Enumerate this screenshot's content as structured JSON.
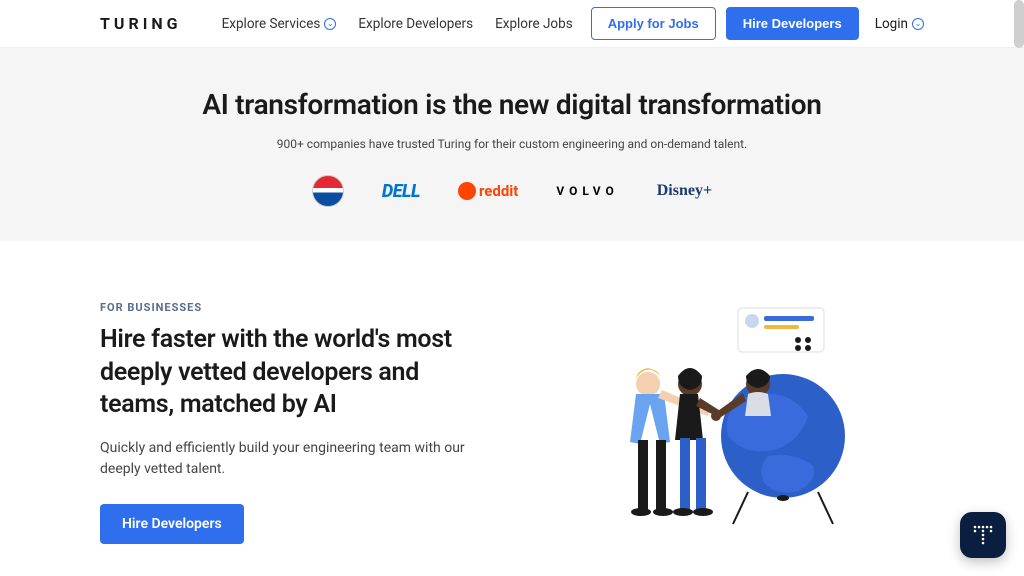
{
  "header": {
    "logo": "TURING",
    "nav": {
      "explore_services": "Explore Services",
      "explore_developers": "Explore Developers",
      "explore_jobs": "Explore Jobs"
    },
    "apply_jobs": "Apply for Jobs",
    "hire_devs": "Hire Developers",
    "login": "Login"
  },
  "hero": {
    "title": "AI transformation is the new digital transformation",
    "subtitle": "900+ companies have trusted Turing for their custom engineering and on-demand talent.",
    "logos": {
      "pepsi": "PEPSI",
      "dell": "DELL",
      "reddit": "reddit",
      "volvo": "VOLVO",
      "disney": "Disney+"
    }
  },
  "business": {
    "eyebrow": "FOR BUSINESSES",
    "heading": "Hire faster with the world's most deeply vetted developers and teams, matched by AI",
    "body": "Quickly and efficiently build your engineering team with our deeply vetted talent.",
    "cta": "Hire Developers"
  },
  "chat_icon": "T"
}
